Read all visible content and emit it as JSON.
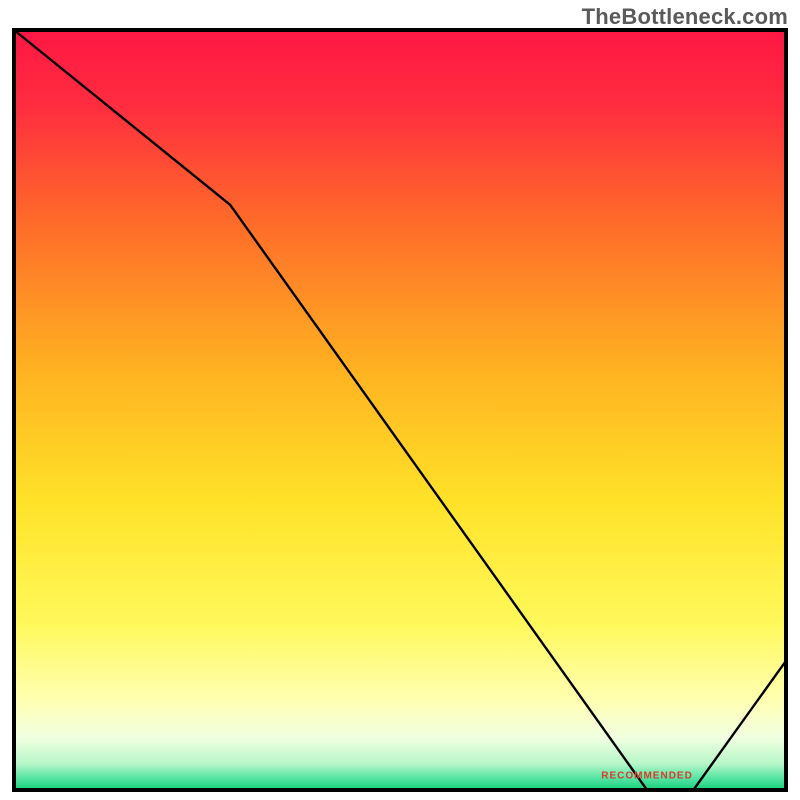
{
  "watermark": "TheBottleneck.com",
  "chart_data": {
    "type": "line",
    "title": "",
    "xlabel": "",
    "ylabel": "",
    "xlim": [
      0,
      100
    ],
    "ylim": [
      0,
      100
    ],
    "x": [
      0,
      28,
      82,
      88,
      100
    ],
    "y": [
      100,
      77,
      0,
      0,
      17
    ],
    "background_gradient": {
      "stops": [
        {
          "offset": 0.0,
          "color": "#ff1744"
        },
        {
          "offset": 0.1,
          "color": "#ff2d3f"
        },
        {
          "offset": 0.25,
          "color": "#ff6a2a"
        },
        {
          "offset": 0.45,
          "color": "#ffb321"
        },
        {
          "offset": 0.62,
          "color": "#ffe228"
        },
        {
          "offset": 0.78,
          "color": "#fff95a"
        },
        {
          "offset": 0.88,
          "color": "#ffffb0"
        },
        {
          "offset": 0.93,
          "color": "#f2ffe0"
        },
        {
          "offset": 0.965,
          "color": "#b7f7c9"
        },
        {
          "offset": 0.985,
          "color": "#52e3a0"
        },
        {
          "offset": 1.0,
          "color": "#17d07d"
        }
      ]
    },
    "bottom_label": {
      "text": "RECOMMENDED",
      "x": 82,
      "y": 1.5,
      "color": "#d83a2b"
    },
    "frame_color": "#000000",
    "line_color": "#000000"
  }
}
